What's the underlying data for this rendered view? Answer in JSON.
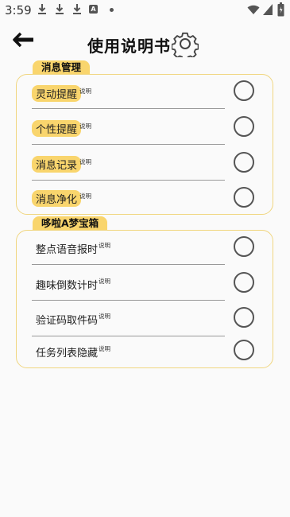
{
  "status_bar": {
    "time": "3:59"
  },
  "header": {
    "title": "使用说明书"
  },
  "sections": [
    {
      "title": "消息管理",
      "items": [
        {
          "label": "灵动提醒",
          "note": "说明"
        },
        {
          "label": "个性提醒",
          "note": "说明"
        },
        {
          "label": "消息记录",
          "note": "说明"
        },
        {
          "label": "消息净化",
          "note": "说明"
        }
      ]
    },
    {
      "title": "哆啦A梦宝箱",
      "items": [
        {
          "label": "整点语音报时",
          "note": "说明"
        },
        {
          "label": "趣味倒数计时",
          "note": "说明"
        },
        {
          "label": "验证码取件码",
          "note": "说明"
        },
        {
          "label": "任务列表隐藏",
          "note": "说明"
        }
      ]
    }
  ],
  "colors": {
    "accent": "#f9d56d",
    "border": "#f0d680"
  }
}
